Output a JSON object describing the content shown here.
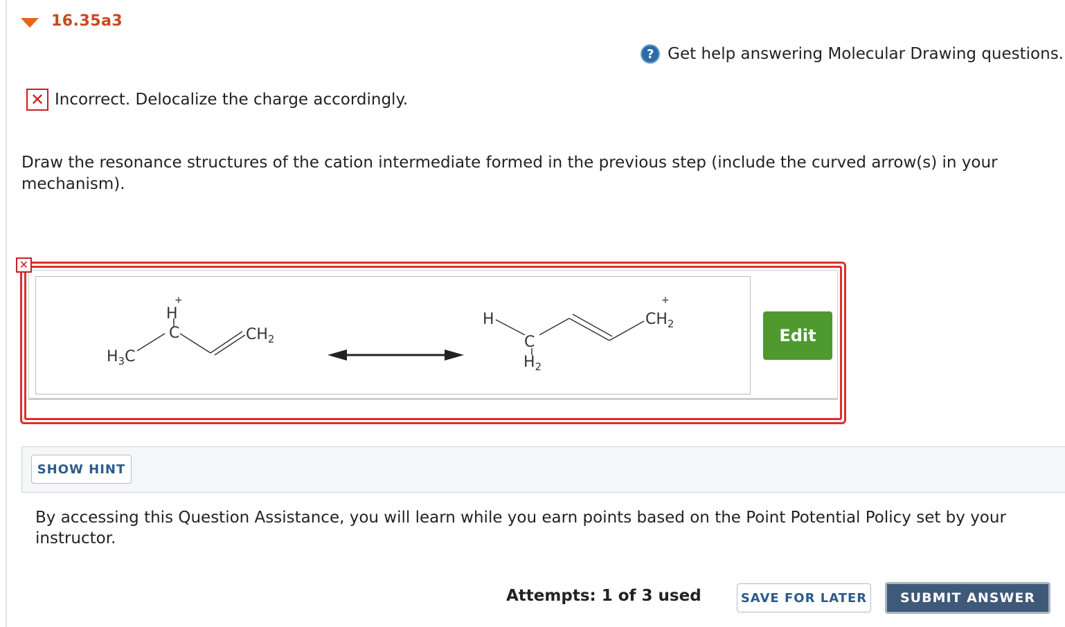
{
  "question": {
    "number": "16.35a3"
  },
  "help": {
    "icon": "question-circle-icon",
    "text": "Get help answering Molecular Drawing questions."
  },
  "feedback": {
    "icon": "x-mark-icon",
    "text": "Incorrect. Delocalize the charge accordingly."
  },
  "prompt": "Draw the resonance structures of the cation intermediate formed in the previous step (include the curved arrow(s) in your mechanism).",
  "drawing": {
    "structure_1": {
      "h3c": "H",
      "h3c_sub": "3",
      "h3c_c": "C",
      "h": "H",
      "c": "C",
      "ch2": "CH",
      "ch2_sub": "2",
      "charge": "+"
    },
    "structure_2": {
      "h": "H",
      "c": "C",
      "h2": "H",
      "h2_sub": "2",
      "ch2": "CH",
      "ch2_sub": "2",
      "charge": "+"
    },
    "edit_label": "Edit"
  },
  "hint": {
    "button_label": "SHOW HINT"
  },
  "assistance_text": "By accessing this Question Assistance, you will learn while you earn points based on the Point Potential Policy set by your instructor.",
  "footer": {
    "attempts": "Attempts: 1 of 3 used",
    "save_label": "SAVE FOR LATER",
    "submit_label": "SUBMIT ANSWER"
  },
  "colors": {
    "accent_orange": "#e8651b",
    "error_red": "#d9302c",
    "edit_green": "#4f9a2e",
    "submit_blue": "#3e5a78",
    "link_blue": "#2c5b8c"
  }
}
